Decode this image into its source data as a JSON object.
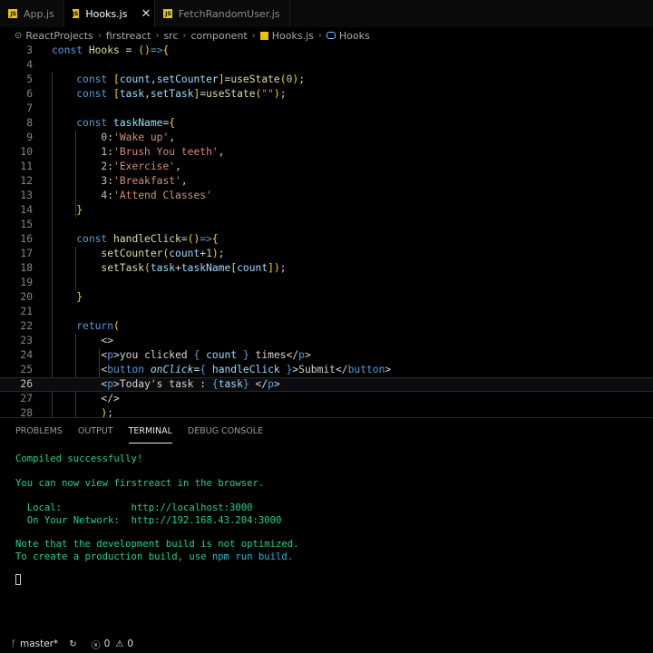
{
  "tabs": [
    {
      "label": "App.js",
      "active": false
    },
    {
      "label": "Hooks.js",
      "active": true
    },
    {
      "label": "FetchRandomUser.js",
      "active": false
    }
  ],
  "breadcrumbs": [
    "ReactProjects",
    "firstreact",
    "src",
    "component",
    "Hooks.js",
    "Hooks"
  ],
  "editor": {
    "line_numbers": [
      "3",
      "4",
      "5",
      "6",
      "7",
      "8",
      "9",
      "10",
      "11",
      "12",
      "13",
      "14",
      "15",
      "16",
      "17",
      "18",
      "19",
      "20",
      "21",
      "22",
      "23",
      "24",
      "25",
      "26",
      "27",
      "28"
    ],
    "current_line": "26",
    "strings": {
      "wake": "'Wake up'",
      "brush": "'Brush You teeth'",
      "exercise": "'Exercise'",
      "breakfast": "'Breakfast'",
      "classes": "'Attend Classes'"
    },
    "texts": {
      "clicked": "you clicked ",
      "times": " times",
      "submit": "Submit",
      "today": "Today's task : "
    }
  },
  "panel": {
    "tabs": [
      "PROBLEMS",
      "OUTPUT",
      "TERMINAL",
      "DEBUG CONSOLE"
    ],
    "active_tab": "TERMINAL",
    "terminal": {
      "compiled": "Compiled successfully!",
      "view_prefix": "You can now view ",
      "app_name": "firstreact",
      "view_suffix": " in the browser.",
      "local_label": "  Local:            ",
      "local_url": "http://localhost:3000",
      "network_label": "  On Your Network:  ",
      "network_url": "http://192.168.43.204:3000",
      "note": "Note that the development build is not optimized.",
      "prod_prefix": "To create a production build, use ",
      "prod_cmd": "npm run build",
      "prod_suffix": "."
    }
  },
  "status": {
    "branch": "master*",
    "errors": "0",
    "warnings": "0"
  }
}
